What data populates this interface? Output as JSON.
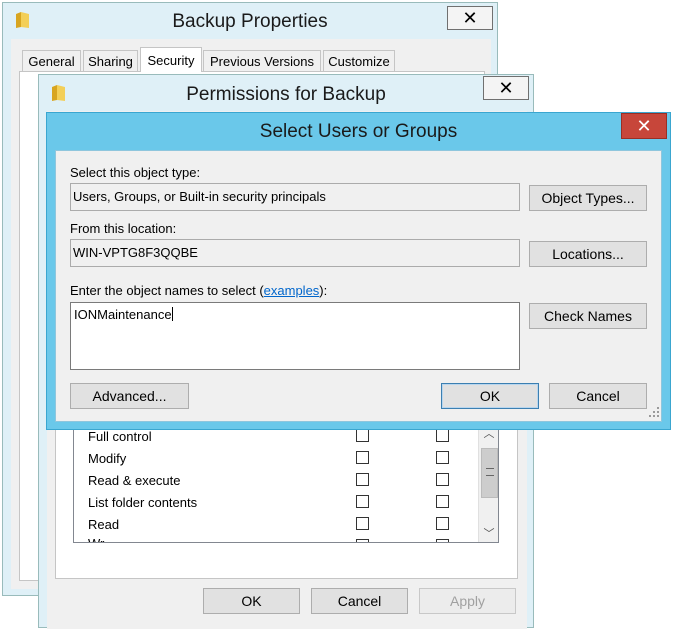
{
  "backup_properties": {
    "title": "Backup Properties",
    "close_symbol": "✕",
    "tabs": [
      "General",
      "Sharing",
      "Security",
      "Previous Versions",
      "Customize"
    ],
    "active_tab": "Security"
  },
  "permissions": {
    "title": "Permissions for Backup",
    "close_symbol": "✕",
    "rows": [
      "Full control",
      "Modify",
      "Read & execute",
      "List folder contents",
      "Read",
      "Wr"
    ],
    "buttons": {
      "ok": "OK",
      "cancel": "Cancel",
      "apply": "Apply"
    }
  },
  "select_users": {
    "title": "Select Users or Groups",
    "close_symbol": "✕",
    "object_type_label": "Select this object type:",
    "object_type_value": "Users, Groups, or Built-in security principals",
    "object_types_button": "Object Types...",
    "location_label": "From this location:",
    "location_value": "WIN-VPTG8F3QQBE",
    "locations_button": "Locations...",
    "names_label_prefix": "Enter the object names to select (",
    "names_label_link": "examples",
    "names_label_suffix": "):",
    "names_value": "IONMaintenance",
    "check_names_button": "Check Names",
    "advanced_button": "Advanced...",
    "ok_button": "OK",
    "cancel_button": "Cancel"
  },
  "colors": {
    "accent_titlebar": "#6ac8ea",
    "close_red": "#c7463a",
    "link": "#0066cc"
  }
}
